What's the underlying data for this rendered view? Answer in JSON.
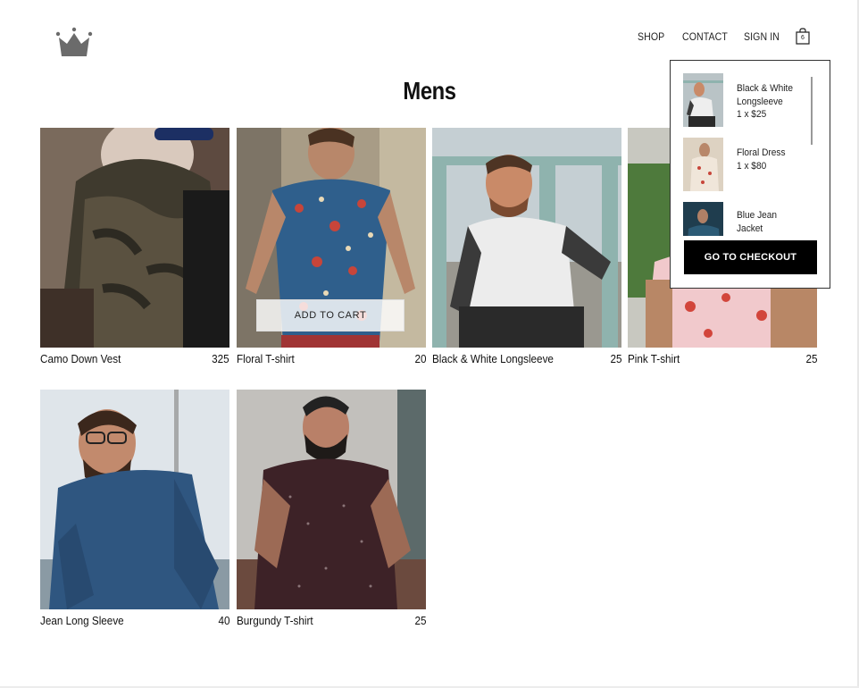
{
  "nav": {
    "shop": "SHOP",
    "contact": "CONTACT",
    "sign_in": "SIGN IN",
    "cart_count": "6"
  },
  "page": {
    "title": "Mens"
  },
  "products": [
    {
      "name": "Camo Down Vest",
      "price": "325"
    },
    {
      "name": "Floral T-shirt",
      "price": "20",
      "button": "ADD TO CART"
    },
    {
      "name": "Black & White Longsleeve",
      "price": "25"
    },
    {
      "name": "Pink T-shirt",
      "price": "25"
    },
    {
      "name": "Jean Long Sleeve",
      "price": "40"
    },
    {
      "name": "Burgundy T-shirt",
      "price": "25"
    }
  ],
  "cart": {
    "items": [
      {
        "name_line1": "Black & White",
        "name_line2": "Longsleeve",
        "qty_price": "1 x $25"
      },
      {
        "name_line1": "Floral Dress",
        "name_line2": "",
        "qty_price": "1 x $80"
      },
      {
        "name_line1": "Blue Jean",
        "name_line2": "Jacket",
        "qty_price": ""
      }
    ],
    "checkout_label": "GO TO CHECKOUT"
  },
  "colors": {
    "accent": "#000000",
    "logo": "#6b6b6b"
  }
}
